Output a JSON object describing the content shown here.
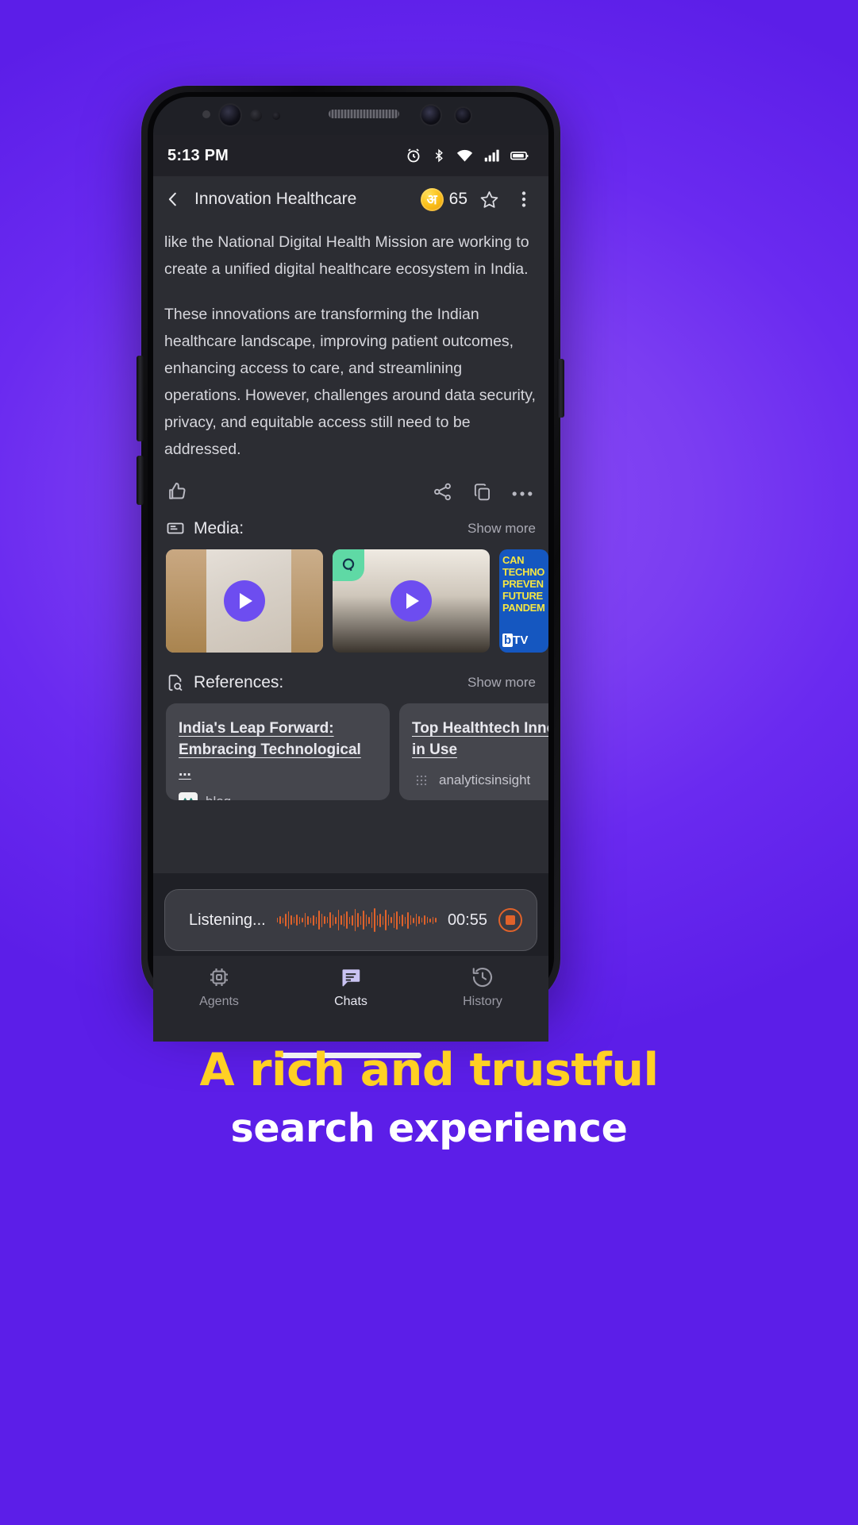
{
  "caption": {
    "line1": "A rich and trustful",
    "line2": "search experience",
    "line1_color": "#ffd024",
    "line2_color": "#ffffff"
  },
  "background": {
    "color": "#7b3df2"
  },
  "status_bar": {
    "time": "5:13 PM",
    "icons": [
      "alarm-icon",
      "bluetooth-icon",
      "wifi-icon",
      "cellular-signal-icon",
      "battery-icon"
    ]
  },
  "app_bar": {
    "back_icon": "chevron-left-icon",
    "title": "Innovation Healthcare",
    "coin_glyph": "अ",
    "coin_count": "65",
    "coin_color": "#fcc21c",
    "star_icon": "star-outline-icon",
    "overflow_icon": "more-vertical-icon"
  },
  "content": {
    "paragraph_1": "like the National Digital Health Mission are working to create a unified digital healthcare ecosystem in India.",
    "paragraph_2": "These innovations are transforming the Indian healthcare landscape, improving patient outcomes, enhancing access to care, and streamlining operations. However, challenges around data security, privacy, and equitable access still need to be addressed.",
    "actions": {
      "thumbs_up": "thumbs-up-icon",
      "share": "share-icon",
      "copy": "copy-icon",
      "more": "more-horizontal-icon"
    }
  },
  "media": {
    "icon": "media-slideshow-icon",
    "title": "Media:",
    "show_more": "Show more",
    "items": [
      {
        "name": "media-thumbnail-hospital-corridor",
        "play": true
      },
      {
        "name": "media-thumbnail-historical-portrait",
        "play": true,
        "badge": "Q"
      },
      {
        "name": "media-thumbnail-btv",
        "play": false,
        "headline": "CAN TECHNO PREVEN FUTURE PANDEM",
        "logo_b": "b",
        "logo_tv": "TV"
      }
    ]
  },
  "references": {
    "icon": "document-search-icon",
    "title": "References:",
    "show_more": "Show more",
    "items": [
      {
        "title": "India's Leap Forward: Embracing Technological ...",
        "source": "blog",
        "favicon": "analytics-vidhya-icon"
      },
      {
        "title": "Top Healthtech Innovations in Use",
        "source": "analyticsinsight",
        "favicon": "analytics-insight-icon"
      }
    ]
  },
  "listening_bar": {
    "label": "Listening...",
    "waveform": "audio-waveform",
    "waveform_color": "#e0622a",
    "time": "00:55",
    "stop_icon": "stop-recording-icon"
  },
  "bottom_nav": {
    "items": [
      {
        "label": "Agents",
        "icon": "chip-agents-icon",
        "active": false
      },
      {
        "label": "Chats",
        "icon": "chat-bubble-icon",
        "active": true
      },
      {
        "label": "History",
        "icon": "history-clock-icon",
        "active": false
      }
    ]
  }
}
